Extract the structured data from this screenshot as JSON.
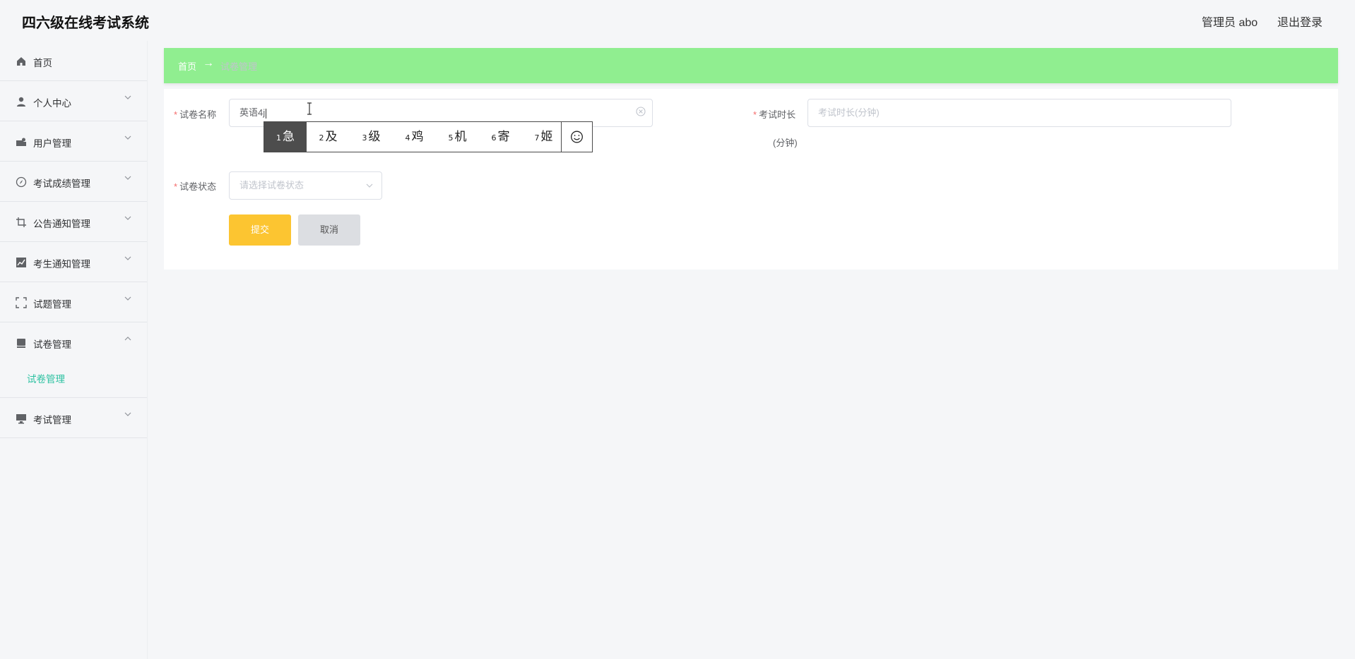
{
  "header": {
    "title": "四六级在线考试系统",
    "user": "管理员 abo",
    "logout": "退出登录"
  },
  "sidebar": {
    "items": [
      {
        "label": "首页",
        "icon": "home-icon"
      },
      {
        "label": "个人中心",
        "icon": "user-icon"
      },
      {
        "label": "用户管理",
        "icon": "users-icon"
      },
      {
        "label": "考试成绩管理",
        "icon": "compass-icon"
      },
      {
        "label": "公告通知管理",
        "icon": "crop-icon"
      },
      {
        "label": "考生通知管理",
        "icon": "chart-icon"
      },
      {
        "label": "试题管理",
        "icon": "fullscreen-icon"
      },
      {
        "label": "试卷管理",
        "icon": "book-icon",
        "expanded": true
      },
      {
        "label": "考试管理",
        "icon": "monitor-icon"
      }
    ],
    "submenu": {
      "label": "试卷管理"
    }
  },
  "breadcrumb": {
    "home": "首页",
    "arrow": "→",
    "current": "试卷管理"
  },
  "form": {
    "required_mark": "*",
    "name": {
      "label": "试卷名称",
      "value": "英语4j"
    },
    "duration": {
      "label": "考试时长",
      "placeholder": "考试时长(分钟)",
      "unit": "(分钟)"
    },
    "status": {
      "label": "试卷状态",
      "placeholder": "请选择试卷状态"
    },
    "submit": "提交",
    "cancel": "取消"
  },
  "ime": {
    "candidates": [
      {
        "num": "1",
        "text": "急"
      },
      {
        "num": "2",
        "text": "及"
      },
      {
        "num": "3",
        "text": "级"
      },
      {
        "num": "4",
        "text": "鸡"
      },
      {
        "num": "5",
        "text": "机"
      },
      {
        "num": "6",
        "text": "寄"
      },
      {
        "num": "7",
        "text": "姬"
      }
    ],
    "selected_index": 0
  },
  "colors": {
    "breadcrumb_bg": "#90ee90",
    "submit_bg": "#fcc531",
    "cancel_bg": "#dcdee2",
    "active_submenu": "#2cc1a1",
    "required": "#f56c6c"
  }
}
